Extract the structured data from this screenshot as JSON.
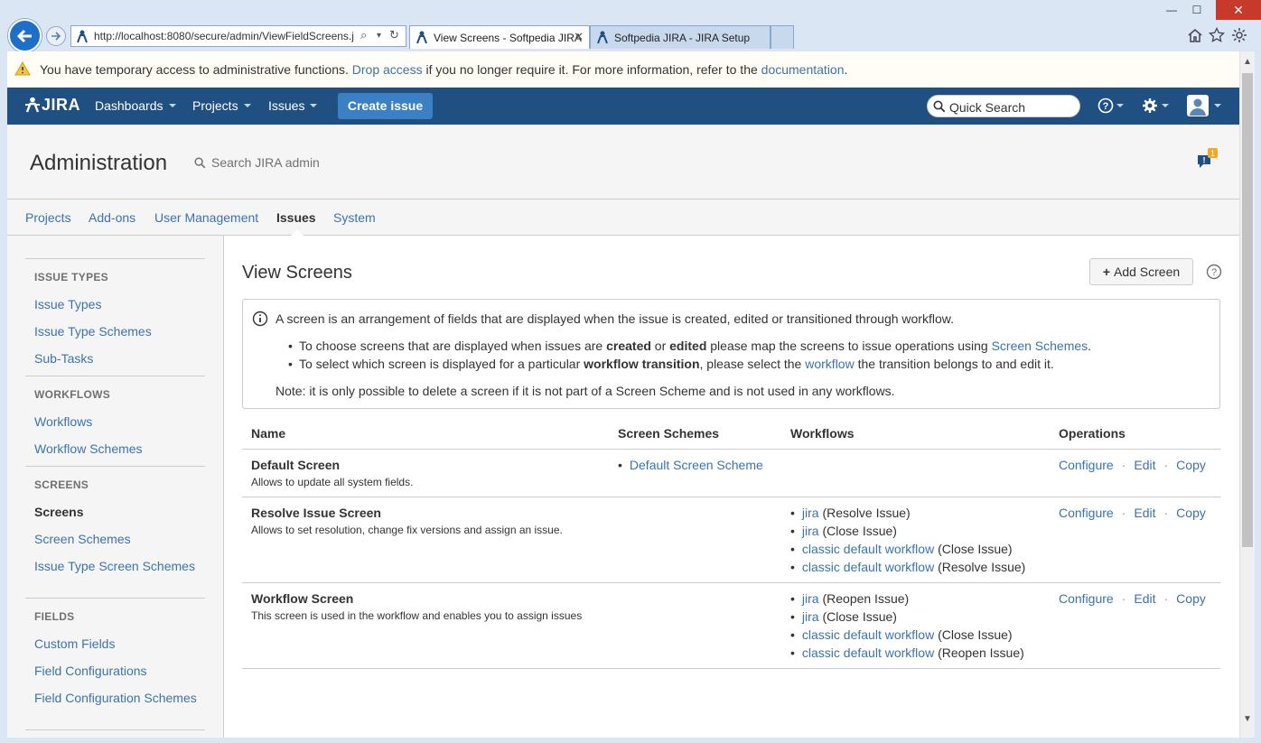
{
  "browser": {
    "url": "http://localhost:8080/secure/admin/ViewFieldScreens.j",
    "tabs": [
      {
        "title": "View Screens - Softpedia JIRA",
        "active": true
      },
      {
        "title": "Softpedia JIRA - JIRA Setup",
        "active": false
      }
    ],
    "icons": [
      "back-icon",
      "forward-icon",
      "search-icon",
      "refresh-icon",
      "home-icon",
      "star-icon",
      "gear-icon"
    ]
  },
  "warning": {
    "prefix": "You have temporary access to administrative functions.",
    "drop_link": "Drop access",
    "middle": "if you no longer require it. For more information, refer to the",
    "doc_link": "documentation",
    "suffix": "."
  },
  "header": {
    "logo": "JIRA",
    "nav": [
      "Dashboards",
      "Projects",
      "Issues"
    ],
    "create_label": "Create issue",
    "quick_search": "Quick Search",
    "colors": {
      "bar": "#205081",
      "create": "#3b7fc4"
    }
  },
  "admin": {
    "title": "Administration",
    "search_placeholder": "Search JIRA admin",
    "notification_count": "1",
    "tabs": [
      "Projects",
      "Add-ons",
      "User Management",
      "Issues",
      "System"
    ],
    "active_tab": "Issues"
  },
  "sidebar": {
    "sections": [
      {
        "heading": "ISSUE TYPES",
        "items": [
          "Issue Types",
          "Issue Type Schemes",
          "Sub-Tasks"
        ]
      },
      {
        "heading": "WORKFLOWS",
        "items": [
          "Workflows",
          "Workflow Schemes"
        ]
      },
      {
        "heading": "SCREENS",
        "items": [
          "Screens",
          "Screen Schemes",
          "Issue Type Screen Schemes"
        ]
      },
      {
        "heading": "FIELDS",
        "items": [
          "Custom Fields",
          "Field Configurations",
          "Field Configuration Schemes"
        ]
      }
    ],
    "active_item": "Screens"
  },
  "main": {
    "title": "View Screens",
    "add_button": "Add Screen",
    "info": {
      "line1": "A screen is an arrangement of fields that are displayed when the issue is created, edited or transitioned through workflow.",
      "b1_a": "To choose screens that are displayed when issues are",
      "b1_bold1": "created",
      "b1_or": "or",
      "b1_bold2": "edited",
      "b1_b": "please map the screens to issue operations using",
      "b1_link": "Screen Schemes",
      "b1_end": ".",
      "b2_a": "To select which screen is displayed for a particular",
      "b2_bold": "workflow transition",
      "b2_b": ", please select the",
      "b2_link": "workflow",
      "b2_c": "the transition belongs to and edit it.",
      "note": "Note: it is only possible to delete a screen if it is not part of a Screen Scheme and is not used in any workflows."
    },
    "table": {
      "headers": [
        "Name",
        "Screen Schemes",
        "Workflows",
        "Operations"
      ],
      "ops": [
        "Configure",
        "Edit",
        "Copy"
      ],
      "rows": [
        {
          "name": "Default Screen",
          "desc": "Allows to update all system fields.",
          "scheme": "Default Screen Scheme",
          "workflows": []
        },
        {
          "name": "Resolve Issue Screen",
          "desc": "Allows to set resolution, change fix versions and assign an issue.",
          "scheme": "",
          "workflows": [
            {
              "link": "jira",
              "note": "(Resolve Issue)"
            },
            {
              "link": "jira",
              "note": "(Close Issue)"
            },
            {
              "link": "classic default workflow",
              "note": "(Close Issue)"
            },
            {
              "link": "classic default workflow",
              "note": "(Resolve Issue)"
            }
          ]
        },
        {
          "name": "Workflow Screen",
          "desc": "This screen is used in the workflow and enables you to assign issues",
          "scheme": "",
          "workflows": [
            {
              "link": "jira",
              "note": "(Reopen Issue)"
            },
            {
              "link": "jira",
              "note": "(Close Issue)"
            },
            {
              "link": "classic default workflow",
              "note": "(Close Issue)"
            },
            {
              "link": "classic default workflow",
              "note": "(Reopen Issue)"
            }
          ]
        }
      ]
    }
  }
}
